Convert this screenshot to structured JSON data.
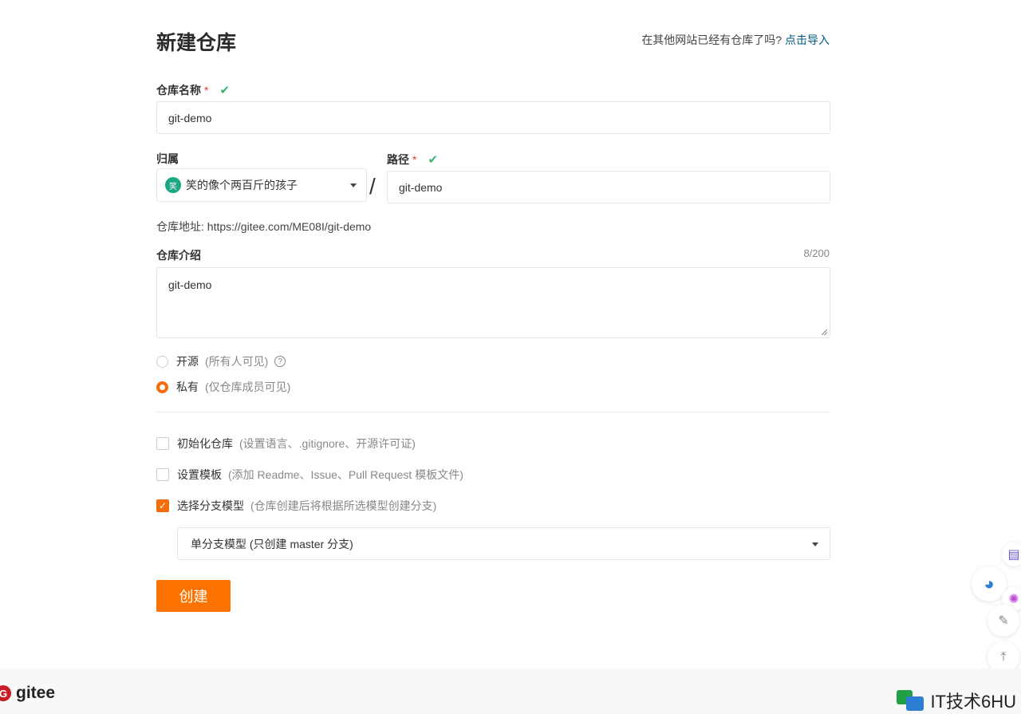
{
  "header": {
    "title": "新建仓库",
    "import_prompt": "在其他网站已经有仓库了吗?",
    "import_link": "点击导入"
  },
  "form": {
    "repo_name": {
      "label": "仓库名称",
      "required_mark": "*",
      "value": "git-demo"
    },
    "owner": {
      "label": "归属",
      "avatar_text": "笑",
      "value": "笑的像个两百斤的孩子"
    },
    "separator": "/",
    "path": {
      "label": "路径",
      "required_mark": "*",
      "value": "git-demo"
    },
    "repo_url_label": "仓库地址:",
    "repo_url_value": "https://gitee.com/ME08I/git-demo",
    "description": {
      "label": "仓库介绍",
      "counter": "8/200",
      "value": "git-demo"
    },
    "visibility": {
      "options": [
        {
          "label": "开源",
          "hint": "(所有人可见)",
          "checked": false,
          "help": "?"
        },
        {
          "label": "私有",
          "hint": "(仅仓库成员可见)",
          "checked": true
        }
      ]
    },
    "options": [
      {
        "label": "初始化仓库",
        "hint": "(设置语言、.gitignore、开源许可证)",
        "checked": false
      },
      {
        "label": "设置模板",
        "hint": "(添加 Readme、Issue、Pull Request 模板文件)",
        "checked": false
      },
      {
        "label": "选择分支模型",
        "hint": "(仓库创建后将根据所选模型创建分支)",
        "checked": true
      }
    ],
    "branch_model": {
      "value": "单分支模型 (只创建 master 分支)"
    },
    "submit_label": "创建"
  },
  "footer": {
    "brand": "gitee",
    "brand_mark": "G"
  },
  "watermark": {
    "text": "IT技术6HU"
  },
  "colors": {
    "accent": "#fe7300",
    "link": "#005980",
    "success": "#3cb371",
    "required": "#e03b3b"
  }
}
